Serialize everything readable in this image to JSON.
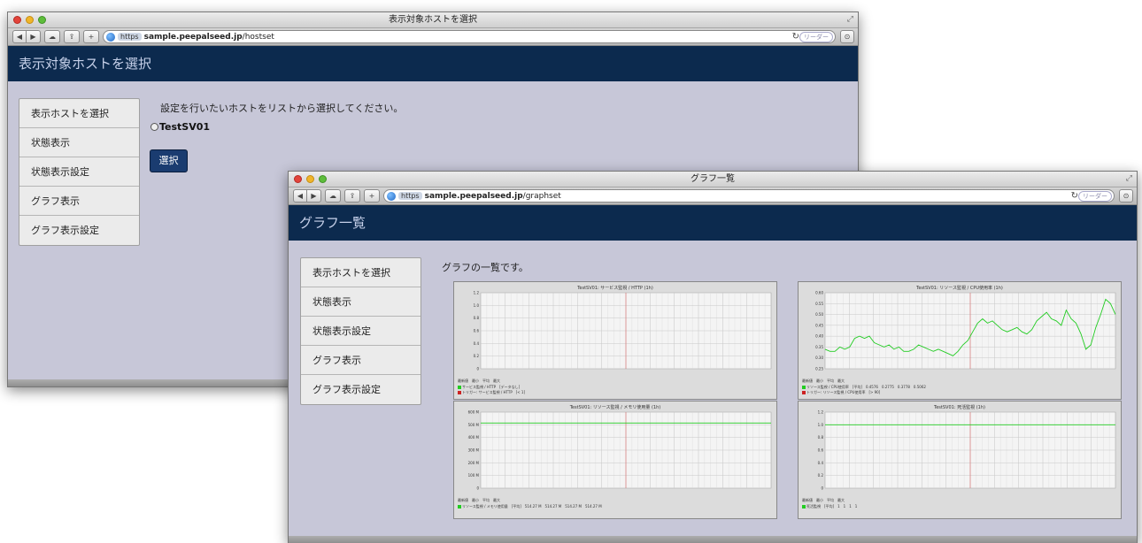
{
  "window1": {
    "title": "表示対象ホストを選択",
    "url_scheme": "https",
    "url_host": "sample.peepalseed.jp",
    "url_path": "/hostset",
    "reader": "リーダー",
    "header": "表示対象ホストを選択",
    "nav": [
      "表示ホストを選択",
      "状態表示",
      "状態表示設定",
      "グラフ表示",
      "グラフ表示設定"
    ],
    "instruction": "設定を行いたいホストをリストから選択してください。",
    "host_option": "TestSV01",
    "select_button": "選択"
  },
  "window2": {
    "title": "グラフ一覧",
    "url_scheme": "https",
    "url_host": "sample.peepalseed.jp",
    "url_path": "/graphset",
    "reader": "リーダー",
    "header": "グラフ一覧",
    "nav": [
      "表示ホストを選択",
      "状態表示",
      "状態表示設定",
      "グラフ表示",
      "グラフ表示設定"
    ],
    "intro": "グラフの一覧です。"
  },
  "colors": {
    "header_bg": "#0c2a4e",
    "page_bg": "#c7c7d8",
    "series": "#22cc22",
    "trigger": "#cc2222"
  },
  "chart_data": [
    {
      "type": "line",
      "title": "TestSV01: サービス監視 / HTTP (1h)",
      "ylim": [
        0,
        1.2
      ],
      "y_ticks": [
        "1.2",
        "1.0",
        "0.8",
        "0.6",
        "0.4",
        "0.2",
        "0"
      ],
      "series": [
        {
          "name": "サービス監視 / HTTP",
          "values": []
        }
      ],
      "legend": [
        "サービス監視 / HTTP　[データなし]",
        "トリガー: サービス監視 / HTTP　[< 1]"
      ],
      "stats_header": "最新値　最小　平均　最大"
    },
    {
      "type": "line",
      "title": "TestSV01: リソース監視 / CPU使用率 (1h)",
      "ylim": [
        0.25,
        0.6
      ],
      "y_ticks": [
        "0.60",
        "0.55",
        "0.50",
        "0.45",
        "0.40",
        "0.35",
        "0.30",
        "0.25"
      ],
      "series": [
        {
          "name": "リソース監視 / CPU使用率",
          "values": [
            0.34,
            0.33,
            0.33,
            0.35,
            0.34,
            0.35,
            0.39,
            0.4,
            0.39,
            0.4,
            0.37,
            0.36,
            0.35,
            0.36,
            0.34,
            0.35,
            0.33,
            0.33,
            0.34,
            0.36,
            0.35,
            0.34,
            0.33,
            0.34,
            0.33,
            0.32,
            0.31,
            0.33,
            0.36,
            0.38,
            0.42,
            0.46,
            0.48,
            0.46,
            0.47,
            0.45,
            0.43,
            0.42,
            0.43,
            0.44,
            0.42,
            0.41,
            0.43,
            0.47,
            0.49,
            0.51,
            0.48,
            0.47,
            0.45,
            0.52,
            0.48,
            0.46,
            0.41,
            0.34,
            0.36,
            0.44,
            0.5,
            0.57,
            0.55,
            0.5
          ]
        }
      ],
      "legend": [
        "リソース監視 / CPU使用率　[平均]　0.4576　0.2775　0.3778　0.5062",
        "トリガー: リソース監視 / CPU使用率　[> 90]"
      ],
      "stats_header": "最新値　最小　平均　最大"
    },
    {
      "type": "line",
      "title": "TestSV01: リソース監視 / メモリ使用量 (1h)",
      "ylim": [
        0,
        600
      ],
      "y_ticks": [
        "600 M",
        "500 M",
        "400 M",
        "300 M",
        "200 M",
        "100 M",
        "0"
      ],
      "series": [
        {
          "name": "リソース監視 / メモリ使用量",
          "values": [
            514.27,
            514.27
          ]
        }
      ],
      "legend": [
        "リソース監視 / メモリ使用量　[平均]　514.27 M　514.27 M　514.27 M　514.27 M"
      ],
      "stats_header": "最新値　最小　平均　最大"
    },
    {
      "type": "line",
      "title": "TestSV01: 死活監視 (1h)",
      "ylim": [
        0,
        1.2
      ],
      "y_ticks": [
        "1.2",
        "1.0",
        "0.8",
        "0.6",
        "0.4",
        "0.2",
        "0"
      ],
      "series": [
        {
          "name": "死活監視",
          "values": [
            1,
            1
          ]
        }
      ],
      "legend": [
        "死活監視　[平均]　1　1　1　1"
      ],
      "stats_header": "最新値　最小　平均　最大"
    }
  ]
}
